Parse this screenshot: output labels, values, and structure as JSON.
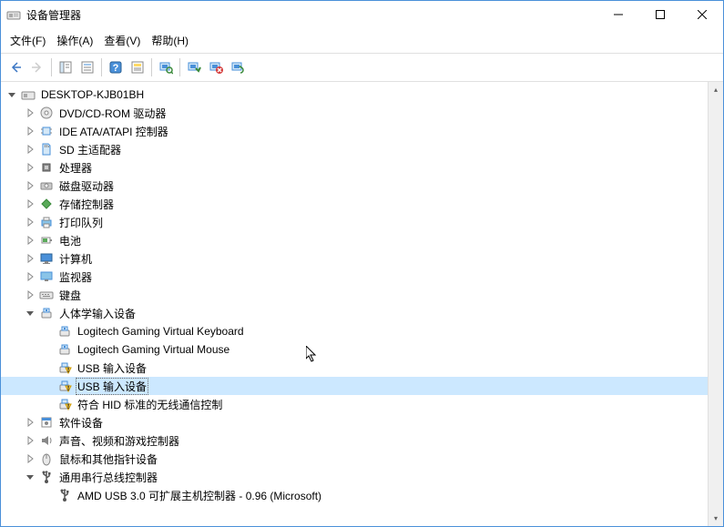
{
  "window": {
    "title": "设备管理器"
  },
  "menu": {
    "file": "文件(F)",
    "action": "操作(A)",
    "view": "查看(V)",
    "help": "帮助(H)"
  },
  "tree": [
    {
      "id": "root",
      "label": "DESKTOP-KJB01BH",
      "icon": "computer",
      "indent": 0,
      "expand": "open",
      "sel": false
    },
    {
      "id": "dvd",
      "label": "DVD/CD-ROM 驱动器",
      "icon": "disc",
      "indent": 1,
      "expand": "closed",
      "sel": false
    },
    {
      "id": "ide",
      "label": "IDE ATA/ATAPI 控制器",
      "icon": "chip",
      "indent": 1,
      "expand": "closed",
      "sel": false
    },
    {
      "id": "sd",
      "label": "SD 主适配器",
      "icon": "sd",
      "indent": 1,
      "expand": "closed",
      "sel": false
    },
    {
      "id": "cpu",
      "label": "处理器",
      "icon": "cpu",
      "indent": 1,
      "expand": "closed",
      "sel": false
    },
    {
      "id": "disk",
      "label": "磁盘驱动器",
      "icon": "drive",
      "indent": 1,
      "expand": "closed",
      "sel": false
    },
    {
      "id": "storage",
      "label": "存储控制器",
      "icon": "storage",
      "indent": 1,
      "expand": "closed",
      "sel": false
    },
    {
      "id": "print",
      "label": "打印队列",
      "icon": "printer",
      "indent": 1,
      "expand": "closed",
      "sel": false
    },
    {
      "id": "battery",
      "label": "电池",
      "icon": "battery",
      "indent": 1,
      "expand": "closed",
      "sel": false
    },
    {
      "id": "computer",
      "label": "计算机",
      "icon": "monitor",
      "indent": 1,
      "expand": "closed",
      "sel": false
    },
    {
      "id": "monitor",
      "label": "监视器",
      "icon": "monitor2",
      "indent": 1,
      "expand": "closed",
      "sel": false
    },
    {
      "id": "keyboard",
      "label": "键盘",
      "icon": "keyboard",
      "indent": 1,
      "expand": "closed",
      "sel": false
    },
    {
      "id": "hid",
      "label": "人体学输入设备",
      "icon": "hid",
      "indent": 1,
      "expand": "open",
      "sel": false
    },
    {
      "id": "hid1",
      "label": "Logitech Gaming Virtual Keyboard",
      "icon": "hid",
      "indent": 2,
      "expand": "none",
      "sel": false
    },
    {
      "id": "hid2",
      "label": "Logitech Gaming Virtual Mouse",
      "icon": "hid",
      "indent": 2,
      "expand": "none",
      "sel": false
    },
    {
      "id": "hid3",
      "label": "USB 输入设备",
      "icon": "hid-warn",
      "indent": 2,
      "expand": "none",
      "sel": false
    },
    {
      "id": "hid4",
      "label": "USB 输入设备",
      "icon": "hid-warn",
      "indent": 2,
      "expand": "none",
      "sel": true
    },
    {
      "id": "hid5",
      "label": "符合 HID 标准的无线通信控制",
      "icon": "hid-warn",
      "indent": 2,
      "expand": "none",
      "sel": false
    },
    {
      "id": "software",
      "label": "软件设备",
      "icon": "software",
      "indent": 1,
      "expand": "closed",
      "sel": false
    },
    {
      "id": "audio",
      "label": "声音、视频和游戏控制器",
      "icon": "audio",
      "indent": 1,
      "expand": "closed",
      "sel": false
    },
    {
      "id": "mouse",
      "label": "鼠标和其他指针设备",
      "icon": "mouse",
      "indent": 1,
      "expand": "closed",
      "sel": false
    },
    {
      "id": "usb",
      "label": "通用串行总线控制器",
      "icon": "usb",
      "indent": 1,
      "expand": "open",
      "sel": false
    },
    {
      "id": "usb1",
      "label": "AMD USB 3.0 可扩展主机控制器 - 0.96 (Microsoft)",
      "icon": "usb",
      "indent": 2,
      "expand": "none",
      "sel": false
    }
  ]
}
